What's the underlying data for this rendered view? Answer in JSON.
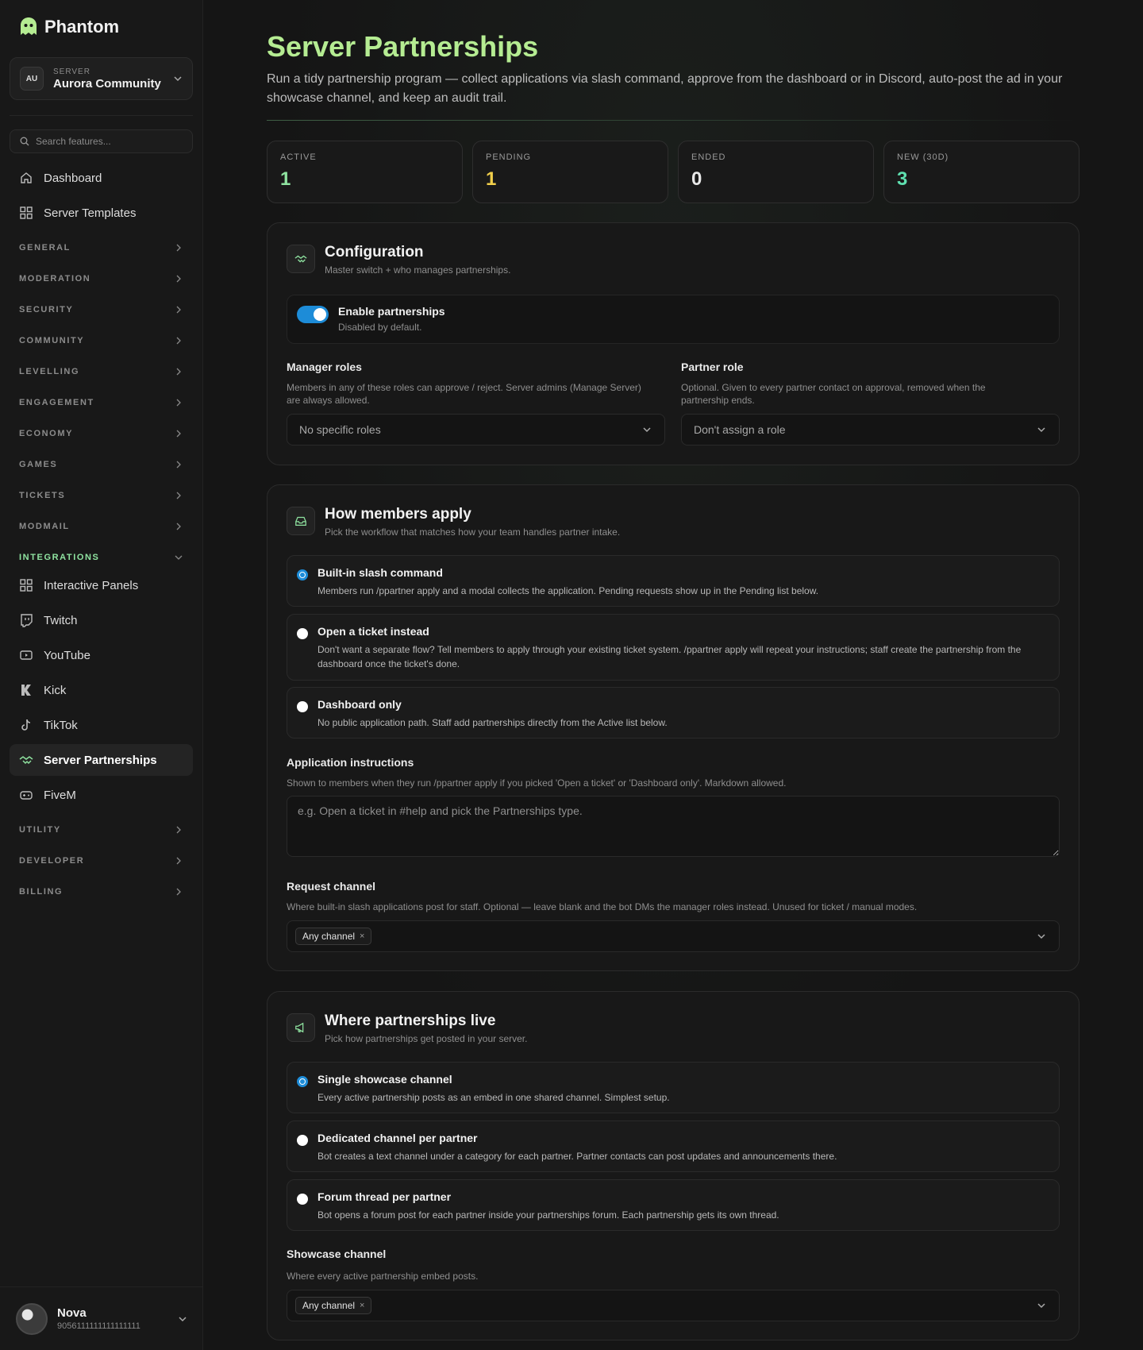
{
  "brand": {
    "name": "Phantom"
  },
  "server": {
    "label": "SERVER",
    "initials": "AU",
    "name": "Aurora Community"
  },
  "search": {
    "placeholder": "Search features..."
  },
  "nav": {
    "dashboard": "Dashboard",
    "server_templates": "Server Templates",
    "sections": [
      "GENERAL",
      "MODERATION",
      "SECURITY",
      "COMMUNITY",
      "LEVELLING",
      "ENGAGEMENT",
      "ECONOMY",
      "GAMES",
      "TICKETS",
      "MODMAIL"
    ],
    "integrations_label": "INTEGRATIONS",
    "integrations": [
      "Interactive Panels",
      "Twitch",
      "YouTube",
      "Kick",
      "TikTok",
      "Server Partnerships",
      "FiveM"
    ],
    "bottom_sections": [
      "UTILITY",
      "DEVELOPER",
      "BILLING"
    ]
  },
  "user": {
    "name": "Nova",
    "id": "9056111111111111111"
  },
  "page": {
    "title": "Server Partnerships",
    "description": "Run a tidy partnership program — collect applications via slash command, approve from the dashboard or in Discord, auto-post the ad in your showcase channel, and keep an audit trail."
  },
  "stats": [
    {
      "label": "ACTIVE",
      "value": "1",
      "color": "#8fe3a0"
    },
    {
      "label": "PENDING",
      "value": "1",
      "color": "#f1cf4b"
    },
    {
      "label": "ENDED",
      "value": "0",
      "color": "#e8e8e8"
    },
    {
      "label": "NEW (30D)",
      "value": "3",
      "color": "#5fe0b0"
    }
  ],
  "configuration": {
    "title": "Configuration",
    "subtitle": "Master switch + who manages partnerships.",
    "toggle_title": "Enable partnerships",
    "toggle_sub": "Disabled by default.",
    "toggle_on": true,
    "manager_label": "Manager roles",
    "manager_help": "Members in any of these roles can approve / reject. Server admins (Manage Server) are always allowed.",
    "manager_value": "No specific roles",
    "partner_label": "Partner role",
    "partner_help": "Optional. Given to every partner contact on approval, removed when the partnership ends.",
    "partner_value": "Don't assign a role"
  },
  "apply": {
    "title": "How members apply",
    "subtitle": "Pick the workflow that matches how your team handles partner intake.",
    "options": [
      {
        "title": "Built-in slash command",
        "desc": "Members run /ppartner apply and a modal collects the application. Pending requests show up in the Pending list below.",
        "selected": true
      },
      {
        "title": "Open a ticket instead",
        "desc": "Don't want a separate flow? Tell members to apply through your existing ticket system. /ppartner apply will repeat your instructions; staff create the partnership from the dashboard once the ticket's done.",
        "selected": false
      },
      {
        "title": "Dashboard only",
        "desc": "No public application path. Staff add partnerships directly from the Active list below.",
        "selected": false
      }
    ],
    "instructions_label": "Application instructions",
    "instructions_help": "Shown to members when they run /ppartner apply if you picked 'Open a ticket' or 'Dashboard only'. Markdown allowed.",
    "instructions_placeholder": "e.g. Open a ticket in #help and pick the Partnerships type.",
    "request_label": "Request channel",
    "request_help": "Where built-in slash applications post for staff. Optional — leave blank and the bot DMs the manager roles instead. Unused for ticket / manual modes.",
    "request_chip": "Any channel"
  },
  "live": {
    "title": "Where partnerships live",
    "subtitle": "Pick how partnerships get posted in your server.",
    "options": [
      {
        "title": "Single showcase channel",
        "desc": "Every active partnership posts as an embed in one shared channel. Simplest setup.",
        "selected": true
      },
      {
        "title": "Dedicated channel per partner",
        "desc": "Bot creates a text channel under a category for each partner. Partner contacts can post updates and announcements there.",
        "selected": false
      },
      {
        "title": "Forum thread per partner",
        "desc": "Bot opens a forum post for each partner inside your partnerships forum. Each partnership gets its own thread.",
        "selected": false
      }
    ],
    "showcase_label": "Showcase channel",
    "showcase_help": "Where every active partnership embed posts.",
    "showcase_chip": "Any channel"
  },
  "chip_remove": "×",
  "accent": "#1d8cd8"
}
